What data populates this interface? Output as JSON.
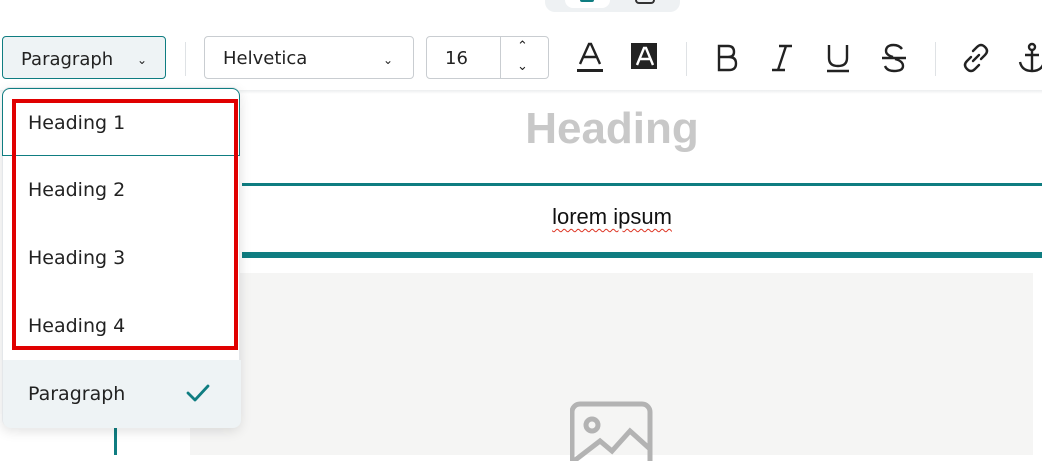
{
  "toolbar": {
    "block_format_label": "Paragraph",
    "font_family_label": "Helvetica",
    "font_size_value": "16"
  },
  "menu": {
    "items": [
      {
        "label": "Heading 1"
      },
      {
        "label": "Heading 2"
      },
      {
        "label": "Heading 3"
      },
      {
        "label": "Heading 4"
      },
      {
        "label": "Paragraph",
        "selected": true
      }
    ]
  },
  "content": {
    "heading": "Heading",
    "body_text": "lorem ipsum"
  },
  "colors": {
    "accent": "#0f7d81",
    "highlight": "#e00000",
    "heading_placeholder": "#c8c8c8"
  },
  "icons": [
    "chevron-down-icon",
    "chevron-up-icon",
    "text-color-icon",
    "highlight-color-icon",
    "bold-icon",
    "italic-icon",
    "underline-icon",
    "strikethrough-icon",
    "link-icon",
    "anchor-icon",
    "image-placeholder-icon",
    "check-icon"
  ]
}
